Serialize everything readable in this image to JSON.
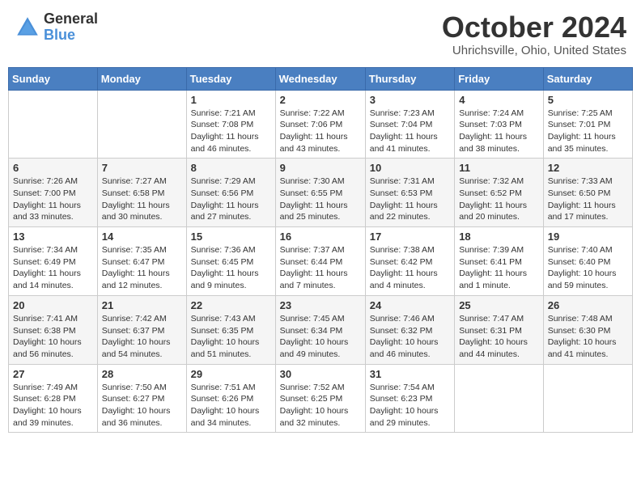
{
  "header": {
    "logo_general": "General",
    "logo_blue": "Blue",
    "month_title": "October 2024",
    "location": "Uhrichsville, Ohio, United States"
  },
  "days_of_week": [
    "Sunday",
    "Monday",
    "Tuesday",
    "Wednesday",
    "Thursday",
    "Friday",
    "Saturday"
  ],
  "weeks": [
    [
      {
        "day": "",
        "info": ""
      },
      {
        "day": "",
        "info": ""
      },
      {
        "day": "1",
        "info": "Sunrise: 7:21 AM\nSunset: 7:08 PM\nDaylight: 11 hours and 46 minutes."
      },
      {
        "day": "2",
        "info": "Sunrise: 7:22 AM\nSunset: 7:06 PM\nDaylight: 11 hours and 43 minutes."
      },
      {
        "day": "3",
        "info": "Sunrise: 7:23 AM\nSunset: 7:04 PM\nDaylight: 11 hours and 41 minutes."
      },
      {
        "day": "4",
        "info": "Sunrise: 7:24 AM\nSunset: 7:03 PM\nDaylight: 11 hours and 38 minutes."
      },
      {
        "day": "5",
        "info": "Sunrise: 7:25 AM\nSunset: 7:01 PM\nDaylight: 11 hours and 35 minutes."
      }
    ],
    [
      {
        "day": "6",
        "info": "Sunrise: 7:26 AM\nSunset: 7:00 PM\nDaylight: 11 hours and 33 minutes."
      },
      {
        "day": "7",
        "info": "Sunrise: 7:27 AM\nSunset: 6:58 PM\nDaylight: 11 hours and 30 minutes."
      },
      {
        "day": "8",
        "info": "Sunrise: 7:29 AM\nSunset: 6:56 PM\nDaylight: 11 hours and 27 minutes."
      },
      {
        "day": "9",
        "info": "Sunrise: 7:30 AM\nSunset: 6:55 PM\nDaylight: 11 hours and 25 minutes."
      },
      {
        "day": "10",
        "info": "Sunrise: 7:31 AM\nSunset: 6:53 PM\nDaylight: 11 hours and 22 minutes."
      },
      {
        "day": "11",
        "info": "Sunrise: 7:32 AM\nSunset: 6:52 PM\nDaylight: 11 hours and 20 minutes."
      },
      {
        "day": "12",
        "info": "Sunrise: 7:33 AM\nSunset: 6:50 PM\nDaylight: 11 hours and 17 minutes."
      }
    ],
    [
      {
        "day": "13",
        "info": "Sunrise: 7:34 AM\nSunset: 6:49 PM\nDaylight: 11 hours and 14 minutes."
      },
      {
        "day": "14",
        "info": "Sunrise: 7:35 AM\nSunset: 6:47 PM\nDaylight: 11 hours and 12 minutes."
      },
      {
        "day": "15",
        "info": "Sunrise: 7:36 AM\nSunset: 6:45 PM\nDaylight: 11 hours and 9 minutes."
      },
      {
        "day": "16",
        "info": "Sunrise: 7:37 AM\nSunset: 6:44 PM\nDaylight: 11 hours and 7 minutes."
      },
      {
        "day": "17",
        "info": "Sunrise: 7:38 AM\nSunset: 6:42 PM\nDaylight: 11 hours and 4 minutes."
      },
      {
        "day": "18",
        "info": "Sunrise: 7:39 AM\nSunset: 6:41 PM\nDaylight: 11 hours and 1 minute."
      },
      {
        "day": "19",
        "info": "Sunrise: 7:40 AM\nSunset: 6:40 PM\nDaylight: 10 hours and 59 minutes."
      }
    ],
    [
      {
        "day": "20",
        "info": "Sunrise: 7:41 AM\nSunset: 6:38 PM\nDaylight: 10 hours and 56 minutes."
      },
      {
        "day": "21",
        "info": "Sunrise: 7:42 AM\nSunset: 6:37 PM\nDaylight: 10 hours and 54 minutes."
      },
      {
        "day": "22",
        "info": "Sunrise: 7:43 AM\nSunset: 6:35 PM\nDaylight: 10 hours and 51 minutes."
      },
      {
        "day": "23",
        "info": "Sunrise: 7:45 AM\nSunset: 6:34 PM\nDaylight: 10 hours and 49 minutes."
      },
      {
        "day": "24",
        "info": "Sunrise: 7:46 AM\nSunset: 6:32 PM\nDaylight: 10 hours and 46 minutes."
      },
      {
        "day": "25",
        "info": "Sunrise: 7:47 AM\nSunset: 6:31 PM\nDaylight: 10 hours and 44 minutes."
      },
      {
        "day": "26",
        "info": "Sunrise: 7:48 AM\nSunset: 6:30 PM\nDaylight: 10 hours and 41 minutes."
      }
    ],
    [
      {
        "day": "27",
        "info": "Sunrise: 7:49 AM\nSunset: 6:28 PM\nDaylight: 10 hours and 39 minutes."
      },
      {
        "day": "28",
        "info": "Sunrise: 7:50 AM\nSunset: 6:27 PM\nDaylight: 10 hours and 36 minutes."
      },
      {
        "day": "29",
        "info": "Sunrise: 7:51 AM\nSunset: 6:26 PM\nDaylight: 10 hours and 34 minutes."
      },
      {
        "day": "30",
        "info": "Sunrise: 7:52 AM\nSunset: 6:25 PM\nDaylight: 10 hours and 32 minutes."
      },
      {
        "day": "31",
        "info": "Sunrise: 7:54 AM\nSunset: 6:23 PM\nDaylight: 10 hours and 29 minutes."
      },
      {
        "day": "",
        "info": ""
      },
      {
        "day": "",
        "info": ""
      }
    ]
  ]
}
